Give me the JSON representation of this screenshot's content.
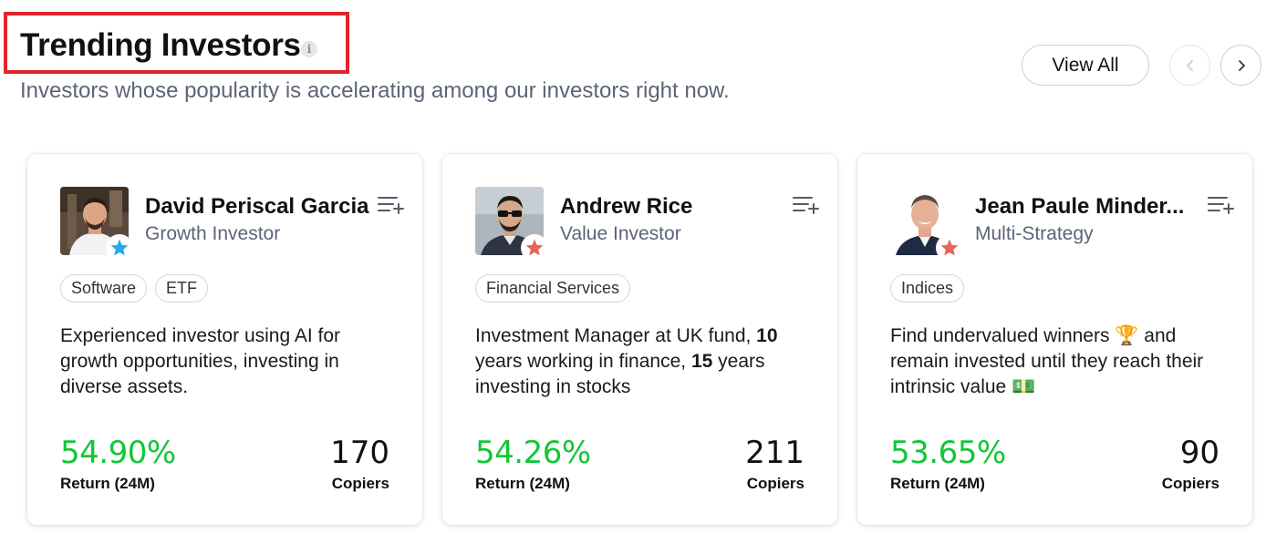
{
  "header": {
    "title": "Trending Investors",
    "info_glyph": "i",
    "subtitle": "Investors whose popularity is accelerating among our investors right now.",
    "view_all_label": "View All"
  },
  "cards": [
    {
      "name": "David Periscal Garcia",
      "role": "Growth Investor",
      "badge_color": "#29a9e8",
      "tags": [
        "Software",
        "ETF"
      ],
      "desc_parts": [
        "Experienced investor using AI for growth opportunities, investing in diverse assets."
      ],
      "return_value": "54.90%",
      "return_label": "Return (24M)",
      "copiers_value": "170",
      "copiers_label": "Copiers"
    },
    {
      "name": "Andrew Rice",
      "role": "Value Investor",
      "badge_color": "#e2675a",
      "tags": [
        "Financial Services"
      ],
      "desc_parts": [
        "Investment Manager at UK fund, ",
        "10",
        " years working in finance, ",
        "15",
        " years investing in stocks"
      ],
      "return_value": "54.26%",
      "return_label": "Return (24M)",
      "copiers_value": "211",
      "copiers_label": "Copiers"
    },
    {
      "name": "Jean Paule Minder...",
      "role": "Multi-Strategy",
      "badge_color": "#e2675a",
      "tags": [
        "Indices"
      ],
      "desc_parts": [
        "Find undervalued winners ",
        "🏆",
        " and remain invested until they reach their intrinsic value ",
        "💵"
      ],
      "return_value": "53.65%",
      "return_label": "Return (24M)",
      "copiers_value": "90",
      "copiers_label": "Copiers"
    }
  ],
  "colors": {
    "highlight_box": "#e0242b",
    "return_green": "#13c636",
    "subtitle_gray": "#5c6478"
  },
  "icons": {
    "info": "info-icon",
    "prev": "chevron-left-icon",
    "next": "chevron-right-icon",
    "watchlist": "add-to-watchlist-icon",
    "badge": "star-icon"
  }
}
